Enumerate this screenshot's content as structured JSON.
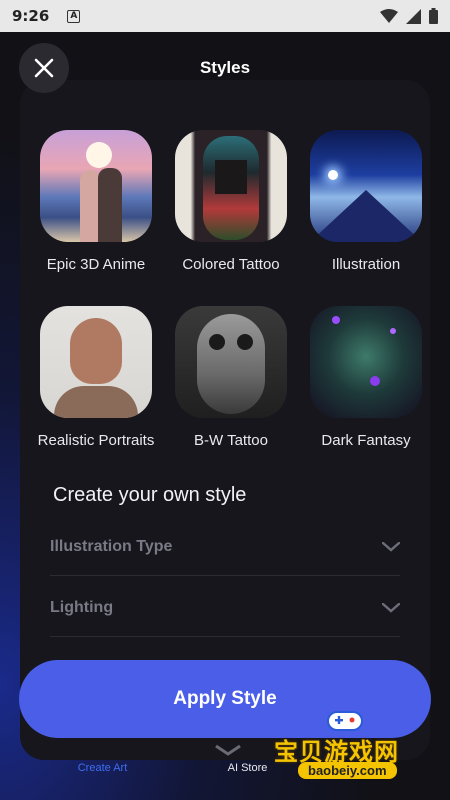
{
  "status_bar": {
    "time": "9:26",
    "notification": "A"
  },
  "header": {
    "title": "Styles"
  },
  "styles": [
    {
      "label": "Epic 3D Anime"
    },
    {
      "label": "Colored Tattoo"
    },
    {
      "label": "Illustration"
    },
    {
      "label": "Realistic Portraits"
    },
    {
      "label": "B-W Tattoo"
    },
    {
      "label": "Dark Fantasy"
    }
  ],
  "create": {
    "title": "Create your own style",
    "dropdowns": [
      {
        "label": "Illustration Type"
      },
      {
        "label": "Lighting"
      }
    ]
  },
  "apply_button": {
    "label": "Apply Style"
  },
  "bottom_nav": {
    "items": [
      {
        "label": "Create Art",
        "icon": "create-art-icon",
        "active": true
      },
      {
        "label": "AI Store",
        "icon": "layers-icon",
        "active": false
      }
    ]
  },
  "watermark": {
    "main": "宝贝游戏网",
    "sub": "baobeiy.com"
  },
  "colors": {
    "accent": "#4a5ee8",
    "active_nav": "#3e6ef0",
    "watermark": "#f5c400"
  }
}
